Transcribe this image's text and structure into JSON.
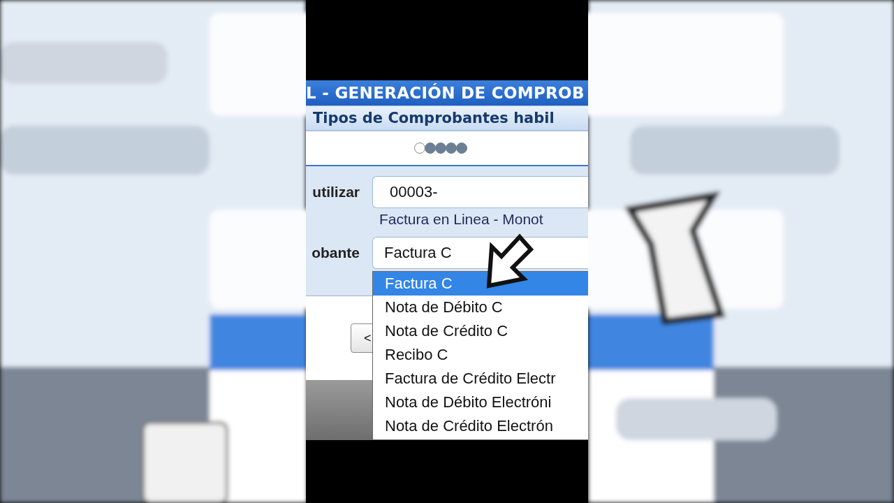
{
  "header": {
    "title": "L - GENERACIÓN DE COMPROB",
    "subtitle": "Tipos de Comprobantes habil"
  },
  "progress": {
    "steps": [
      {
        "filled": false
      },
      {
        "filled": true
      },
      {
        "filled": true
      },
      {
        "filled": true
      },
      {
        "filled": true
      }
    ]
  },
  "form": {
    "point_of_sale": {
      "label": "utilizar",
      "value": "00003-",
      "note": "Factura en Linea - Monot"
    },
    "voucher_type": {
      "label": "obante",
      "value": "Factura C",
      "options": [
        {
          "label": "Factura C",
          "selected": true
        },
        {
          "label": "Nota de Débito C",
          "selected": false
        },
        {
          "label": "Nota de Crédito C",
          "selected": false
        },
        {
          "label": "Recibo C",
          "selected": false
        },
        {
          "label": "Factura de Crédito Electr",
          "selected": false
        },
        {
          "label": "Nota de Débito Electróni",
          "selected": false
        },
        {
          "label": "Nota de Crédito Electrón",
          "selected": false
        }
      ]
    }
  },
  "back_button": {
    "label": "<"
  }
}
